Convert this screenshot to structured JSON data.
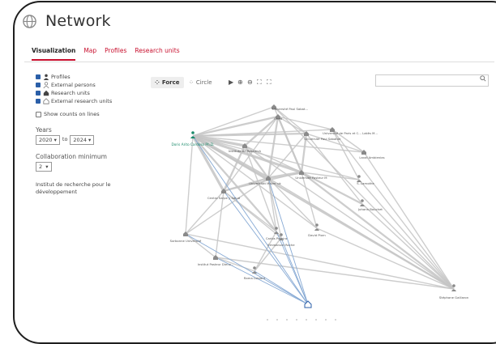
{
  "header": {
    "title": "Network"
  },
  "tabs": [
    {
      "label": "Visualization",
      "active": true
    },
    {
      "label": "Map",
      "active": false
    },
    {
      "label": "Profiles",
      "active": false
    },
    {
      "label": "Research units",
      "active": false
    }
  ],
  "filters": {
    "profiles": "Profiles",
    "external_persons": "External persons",
    "research_units": "Research units",
    "external_research_units": "External research units",
    "show_counts": "Show counts on lines"
  },
  "years": {
    "label": "Years",
    "from": "2020",
    "to_word": "to",
    "to": "2024"
  },
  "collaboration": {
    "label": "Collaboration minimum",
    "value": "2"
  },
  "institute_text": "Institut de recherche pour le développement",
  "toolbar": {
    "force_label": "Force",
    "circle_label": "Circle"
  },
  "search": {
    "placeholder": ""
  },
  "colors": {
    "accent": "#c8102e",
    "checkbox": "#2b5fa8",
    "highlight": "#1a8a6a",
    "edge_gray": "#c4c4c4",
    "edge_blue": "#86a9d4"
  },
  "network": {
    "nodes": [
      {
        "id": "n0",
        "label": "Doris Arito Cardoso Ph.D.",
        "kind": "profile",
        "highlight": true
      },
      {
        "id": "n1",
        "label": "Université Paul Sabat...",
        "kind": "unit"
      },
      {
        "id": "n2",
        "label": "Cirad",
        "kind": "unit"
      },
      {
        "id": "n3",
        "label": "Université de Paris et C... Lakès M...",
        "kind": "unit"
      },
      {
        "id": "n4",
        "label": "Institute de Research",
        "kind": "unit"
      },
      {
        "id": "n5",
        "label": "Université Paul Sabatier",
        "kind": "unit"
      },
      {
        "id": "n6",
        "label": "Laval Ambienias",
        "kind": "unit"
      },
      {
        "id": "n7",
        "label": "Université Pasteur M",
        "kind": "unit"
      },
      {
        "id": "n8",
        "label": "Universität Mayer uk",
        "kind": "unit"
      },
      {
        "id": "n9",
        "label": "S. Lamothe",
        "kind": "person"
      },
      {
        "id": "n10",
        "label": "Centro Sarpe y Salud",
        "kind": "unit"
      },
      {
        "id": "n11",
        "label": "Johann Bouchet",
        "kind": "person"
      },
      {
        "id": "n12",
        "label": "Sorbonne Université",
        "kind": "unit"
      },
      {
        "id": "n13",
        "label": "Carlos Pereira",
        "kind": "person"
      },
      {
        "id": "n14",
        "label": "David Piorn",
        "kind": "person"
      },
      {
        "id": "n15",
        "label": "Emmanuel Roche",
        "kind": "person"
      },
      {
        "id": "n16",
        "label": "Institut Pasteur Dieuv...",
        "kind": "unit"
      },
      {
        "id": "n17",
        "label": "Rama Lubiant",
        "kind": "person"
      },
      {
        "id": "n18",
        "label": "Stéphane Gaillaron",
        "kind": "person"
      },
      {
        "id": "n19",
        "label": "",
        "kind": "research-unit"
      }
    ],
    "edges": [
      [
        "n0",
        "n1",
        1
      ],
      [
        "n0",
        "n2",
        2
      ],
      [
        "n0",
        "n3",
        1
      ],
      [
        "n0",
        "n4",
        3
      ],
      [
        "n0",
        "n5",
        2
      ],
      [
        "n0",
        "n7",
        3
      ],
      [
        "n0",
        "n8",
        4
      ],
      [
        "n0",
        "n10",
        3
      ],
      [
        "n0",
        "n12",
        1
      ],
      [
        "n0",
        "n13",
        2
      ],
      [
        "n0",
        "n14",
        1
      ],
      [
        "n0",
        "n6",
        1
      ],
      [
        "n0",
        "n9",
        1
      ],
      [
        "n0",
        "n18",
        2
      ],
      [
        "n2",
        "n3",
        1
      ],
      [
        "n2",
        "n4",
        2
      ],
      [
        "n2",
        "n5",
        1
      ],
      [
        "n2",
        "n7",
        2
      ],
      [
        "n2",
        "n8",
        2
      ],
      [
        "n2",
        "n10",
        1
      ],
      [
        "n4",
        "n8",
        2
      ],
      [
        "n4",
        "n7",
        1
      ],
      [
        "n4",
        "n10",
        2
      ],
      [
        "n4",
        "n13",
        1
      ],
      [
        "n5",
        "n7",
        2
      ],
      [
        "n5",
        "n8",
        1
      ],
      [
        "n5",
        "n6",
        1
      ],
      [
        "n5",
        "n11",
        1
      ],
      [
        "n7",
        "n8",
        3
      ],
      [
        "n7",
        "n9",
        1
      ],
      [
        "n7",
        "n11",
        2
      ],
      [
        "n7",
        "n10",
        1
      ],
      [
        "n7",
        "n14",
        1
      ],
      [
        "n7",
        "n18",
        2
      ],
      [
        "n8",
        "n10",
        2
      ],
      [
        "n8",
        "n13",
        1
      ],
      [
        "n8",
        "n14",
        1
      ],
      [
        "n8",
        "n12",
        1
      ],
      [
        "n8",
        "n18",
        1
      ],
      [
        "n8",
        "n15",
        1
      ],
      [
        "n10",
        "n12",
        1
      ],
      [
        "n10",
        "n13",
        1
      ],
      [
        "n10",
        "n16",
        1
      ],
      [
        "n10",
        "n15",
        1
      ],
      [
        "n3",
        "n6",
        1
      ],
      [
        "n3",
        "n9",
        1
      ],
      [
        "n3",
        "n18",
        1
      ],
      [
        "n6",
        "n18",
        1
      ],
      [
        "n9",
        "n18",
        1
      ],
      [
        "n11",
        "n18",
        1
      ],
      [
        "n12",
        "n16",
        1
      ],
      [
        "n13",
        "n15",
        1
      ],
      [
        "n13",
        "n17",
        1
      ],
      [
        "n14",
        "n18",
        1
      ],
      [
        "n15",
        "n17",
        1
      ],
      [
        "n16",
        "n17",
        1
      ],
      [
        "n1",
        "n5",
        1
      ],
      [
        "n1",
        "n7",
        1
      ],
      [
        "n1",
        "n18",
        1
      ],
      [
        "n12",
        "n18",
        1
      ],
      [
        "n16",
        "n18",
        1
      ],
      [
        "n4",
        "n18",
        1
      ]
    ],
    "blue_edges": [
      [
        "n19",
        "n17"
      ],
      [
        "n19",
        "n15"
      ],
      [
        "n19",
        "n16"
      ],
      [
        "n19",
        "n13"
      ],
      [
        "n19",
        "n10"
      ],
      [
        "n19",
        "n8"
      ],
      [
        "n19",
        "n12"
      ],
      [
        "n19",
        "n0"
      ]
    ]
  }
}
